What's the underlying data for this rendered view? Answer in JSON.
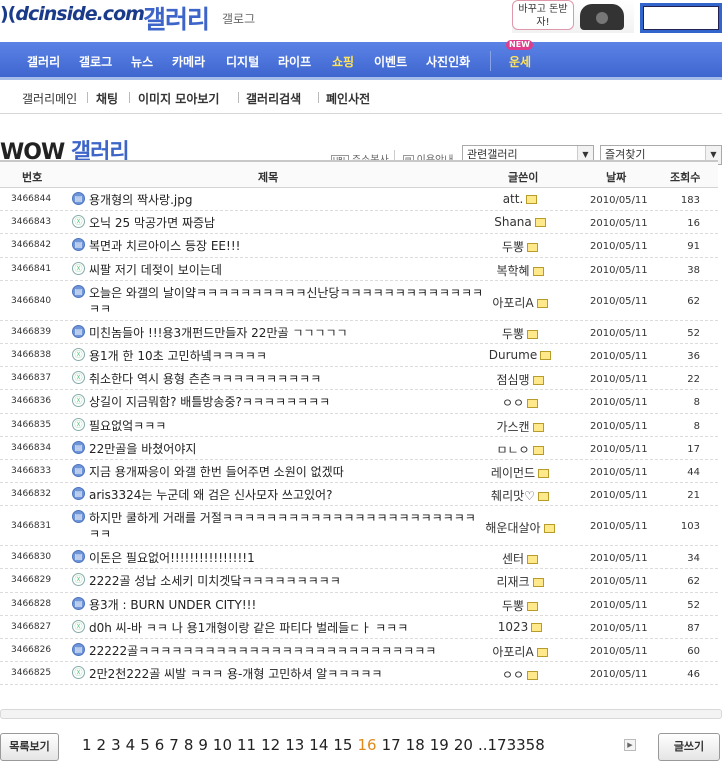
{
  "header": {
    "logo": "dcinside.com",
    "gallery_title": "갤러리",
    "gallery_sub": "갤로그",
    "promo_text": "바꾸고 돈받자!"
  },
  "nav": {
    "items": [
      "갤러리",
      "갤로그",
      "뉴스",
      "카메라",
      "디지털",
      "라이프",
      "쇼핑",
      "이벤트",
      "사진인화"
    ],
    "fortune": "운세",
    "new_badge": "NEW"
  },
  "subnav": {
    "items": [
      "갤러리메인",
      "채팅",
      "이미지 모아보기",
      "갤러리검색",
      "폐인사전"
    ]
  },
  "gallery": {
    "name_en": "WOW",
    "name_ko": "갤러리",
    "address_copy": "주소복사",
    "usage_guide": "이용안내",
    "related_select": "관련갤러리",
    "favorites_select": "즐겨찾기"
  },
  "table": {
    "headers": {
      "num": "번호",
      "subject": "제목",
      "author": "글쓴이",
      "date": "날짜",
      "hits": "조회수"
    },
    "rows": [
      {
        "num": "3466844",
        "icon": "pic",
        "subject": "용개형의 짝사랑.jpg",
        "author": "att.",
        "date": "2010/05/11",
        "hits": "183"
      },
      {
        "num": "3466843",
        "icon": "txt",
        "subject": "오닉 25 막공가면 짜증남",
        "author": "Shana",
        "date": "2010/05/11",
        "hits": "16"
      },
      {
        "num": "3466842",
        "icon": "pic",
        "subject": "복면과 치르아이스 등장 EE!!!",
        "author": "두뽕",
        "date": "2010/05/11",
        "hits": "91"
      },
      {
        "num": "3466841",
        "icon": "txt",
        "subject": "씨팔 저기 데젖이 보이는데",
        "author": "복학혜",
        "date": "2010/05/11",
        "hits": "38"
      },
      {
        "num": "3466840",
        "icon": "pic",
        "subject": "오늘은 와갤의 날이얔ㅋㅋㅋㅋㅋㅋㅋㅋㅋㅋ신난당ㅋㅋㅋㅋㅋㅋㅋㅋㅋㅋㅋㅋㅋㅋㅋ",
        "author": "아포리A",
        "date": "2010/05/11",
        "hits": "62",
        "tall": true
      },
      {
        "num": "3466839",
        "icon": "pic",
        "subject": "미친놈들아 !!!용3개펀드만들자 22만골 ㄱㄱㄱㄱㄱ",
        "author": "두뽕",
        "date": "2010/05/11",
        "hits": "52"
      },
      {
        "num": "3466838",
        "icon": "txt",
        "subject": "용1개 한 10초 고민하넼ㅋㅋㅋㅋㅋ",
        "author": "Durume",
        "date": "2010/05/11",
        "hits": "36"
      },
      {
        "num": "3466837",
        "icon": "txt",
        "subject": "취소한다 역시 용형 츤츤ㅋㅋㅋㅋㅋㅋㅋㅋㅋㅋ",
        "author": "점심맹",
        "date": "2010/05/11",
        "hits": "22"
      },
      {
        "num": "3466836",
        "icon": "txt",
        "subject": "상길이 지금뭐함? 배틀방송중?ㅋㅋㅋㅋㅋㅋㅋㅋ",
        "author": "ㅇㅇ",
        "date": "2010/05/11",
        "hits": "8"
      },
      {
        "num": "3466835",
        "icon": "txt",
        "subject": "필요없엌ㅋㅋㅋ",
        "author": "가스캔",
        "date": "2010/05/11",
        "hits": "8"
      },
      {
        "num": "3466834",
        "icon": "pic",
        "subject": "22만골을 바쳤어야지",
        "author": "ㅁㄴㅇ",
        "date": "2010/05/11",
        "hits": "17"
      },
      {
        "num": "3466833",
        "icon": "pic",
        "subject": "지금 용개짜응이 와갤 한번 들어주면 소원이 없겠따",
        "author": "레이먼드",
        "date": "2010/05/11",
        "hits": "44"
      },
      {
        "num": "3466832",
        "icon": "pic",
        "subject": "aris3324는 누군데 왜 검은 신사모자 쓰고있어?",
        "author": "췌리맛♡",
        "date": "2010/05/11",
        "hits": "21"
      },
      {
        "num": "3466831",
        "icon": "pic",
        "subject": "하지만 쿨하게 거래를 거절ㅋㅋㅋㅋㅋㅋㅋㅋㅋㅋㅋㅋㅋㅋㅋㅋㅋㅋㅋㅋㅋㅋㅋㅋㅋ",
        "author": "해운대살아",
        "date": "2010/05/11",
        "hits": "103",
        "tall": true
      },
      {
        "num": "3466830",
        "icon": "pic",
        "subject": "이돈은 필요없어!!!!!!!!!!!!!!!!1",
        "author": "센터",
        "date": "2010/05/11",
        "hits": "34"
      },
      {
        "num": "3466829",
        "icon": "txt",
        "subject": "2222골 성납 소세키 미치겟닼ㅋㅋㅋㅋㅋㅋㅋㅋㅋ",
        "author": "리재크",
        "date": "2010/05/11",
        "hits": "62"
      },
      {
        "num": "3466828",
        "icon": "pic",
        "subject": "용3개 : BURN UNDER CITY!!!",
        "author": "두뽕",
        "date": "2010/05/11",
        "hits": "52"
      },
      {
        "num": "3466827",
        "icon": "txt",
        "subject": "d0h 씨-바 ㅋㅋ 나 용1개형이랑 같은 파티다 벌레들ㄷㅏ ㅋㅋㅋ",
        "author": "1023",
        "date": "2010/05/11",
        "hits": "87"
      },
      {
        "num": "3466826",
        "icon": "pic",
        "subject": "22222골ㅋㅋㅋㅋㅋㅋㅋㅋㅋㅋㅋㅋㅋㅋㅋㅋㅋㅋㅋㅋㅋㅋㅋㅋㅋㅋㅋ",
        "author": "아포리A",
        "date": "2010/05/11",
        "hits": "60"
      },
      {
        "num": "3466825",
        "icon": "txt",
        "subject": "2만2천222골 씨발 ㅋㅋㅋ 용-개형 고민하셔 알ㅋㅋㅋㅋㅋ",
        "author": "ㅇㅇ",
        "date": "2010/05/11",
        "hits": "46"
      }
    ]
  },
  "footer": {
    "list_button": "목록보기",
    "write_button": "글쓰기",
    "pages": [
      "1",
      "2",
      "3",
      "4",
      "5",
      "6",
      "7",
      "8",
      "9",
      "10",
      "11",
      "12",
      "13",
      "14",
      "15",
      "16",
      "17",
      "18",
      "19",
      "20"
    ],
    "current_page": "16",
    "last_page": "..173358",
    "accent_color": "#e08a1b"
  }
}
